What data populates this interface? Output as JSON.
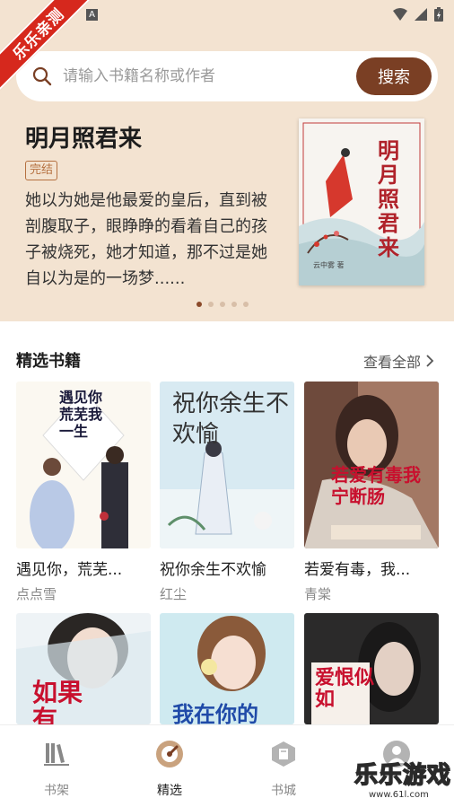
{
  "ribbon_text": "乐乐亲测",
  "status": {
    "badge": "A"
  },
  "search": {
    "placeholder": "请输入书籍名称或作者",
    "button": "搜索"
  },
  "banner": {
    "title": "明月照君来",
    "badge": "完结",
    "description": "她以为她是他最爱的皇后，直到被剖腹取子，眼睁睁的看着自己的孩子被烧死，她才知道，那不过是她自以为是的一场梦......",
    "cover_title": "明月照君来",
    "cover_author": "云中雾 著",
    "dots": 5,
    "active_dot": 0
  },
  "section": {
    "title": "精选书籍",
    "see_all": "查看全部"
  },
  "books": [
    {
      "title": "遇见你，荒芜...",
      "author": "点点雪",
      "cover_text": "遇见你荒芜我一生"
    },
    {
      "title": "祝你余生不欢愉",
      "author": "红尘",
      "cover_text": "祝你余生不欢愉"
    },
    {
      "title": "若爱有毒，我...",
      "author": "青棠",
      "cover_text": "若爱有毒我宁断肠"
    },
    {
      "title": "",
      "author": "",
      "cover_text": "如果有"
    },
    {
      "title": "",
      "author": "",
      "cover_text": "我在你的"
    },
    {
      "title": "",
      "author": "",
      "cover_text": "爱恨似如"
    }
  ],
  "tabs": [
    {
      "label": "书架",
      "icon": "bookshelf-icon"
    },
    {
      "label": "精选",
      "icon": "featured-icon"
    },
    {
      "label": "书城",
      "icon": "bookstore-icon"
    },
    {
      "label": "",
      "icon": "profile-icon"
    }
  ],
  "active_tab": 1,
  "watermark": {
    "text": "乐乐游戏",
    "url": "www.61l.com"
  },
  "colors": {
    "accent": "#7a3f24",
    "header_bg": "#f3e3d1",
    "ribbon": "#d6281d"
  }
}
